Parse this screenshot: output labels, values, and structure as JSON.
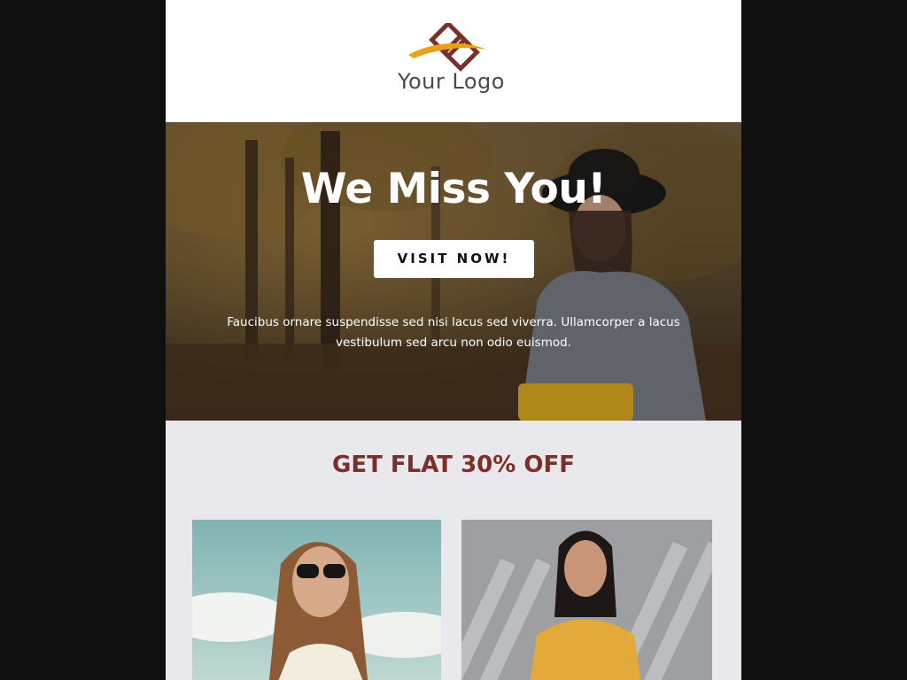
{
  "header": {
    "logo_text": "Your Logo",
    "logo_colors": {
      "mark": "#7a2f28",
      "swoosh": "#e8a21a",
      "text": "#4a4a4a"
    }
  },
  "hero": {
    "title": "We Miss You!",
    "button_label": "VISIT NOW!",
    "body_text": "Faucibus ornare suspendisse sed nisi lacus sed viverra. Ullamcorper a lacus vestibulum sed arcu non odio euismod."
  },
  "offer": {
    "title": "GET FLAT 30% OFF",
    "title_color": "#7a2f28",
    "background": "#e9e8ec"
  },
  "products": [
    {
      "image": "woman-in-sunglasses-photo"
    },
    {
      "image": "woman-in-yellow-dress-photo"
    }
  ]
}
